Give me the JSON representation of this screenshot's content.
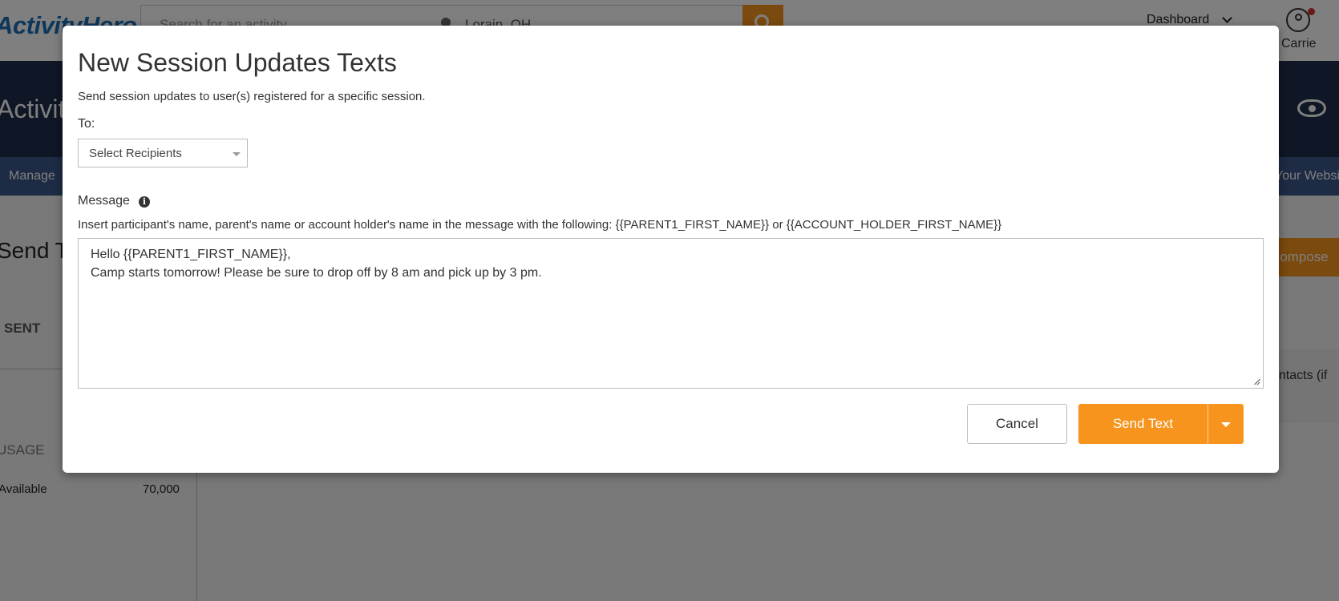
{
  "header": {
    "logo_text": "ActivityHero",
    "search_placeholder": "Search for an activity",
    "location_value": "Lorain, OH",
    "dashboard_label": "Dashboard",
    "user_name": "Carrie"
  },
  "banner": {
    "title": "Activity Provider"
  },
  "nav": {
    "manage_label": "Manage",
    "website_label": "Your Website"
  },
  "page": {
    "title": "Send Texts",
    "compose_label": "Compose",
    "tab_sent": "SENT",
    "usage_heading": "USAGE",
    "available_label": "Available",
    "available_value": "70,000",
    "contacts_text": "contacts (if"
  },
  "modal": {
    "title": "New Session Updates Texts",
    "subtitle": "Send session updates to user(s) registered for a specific session.",
    "to_label": "To:",
    "recipients_placeholder": "Select Recipients",
    "message_label": "Message",
    "message_hint": "Insert participant's name, parent's name or account holder's name in the message with the following: {{PARENT1_FIRST_NAME}} or {{ACCOUNT_HOLDER_FIRST_NAME}}",
    "message_value": "Hello {{PARENT1_FIRST_NAME}},\nCamp starts tomorrow! Please be sure to drop off by 8 am and pick up by 3 pm.",
    "cancel_label": "Cancel",
    "send_label": "Send Text"
  },
  "colors": {
    "accent": "#f7941d",
    "banner": "#1e2d4a",
    "nav": "#3b5788"
  }
}
